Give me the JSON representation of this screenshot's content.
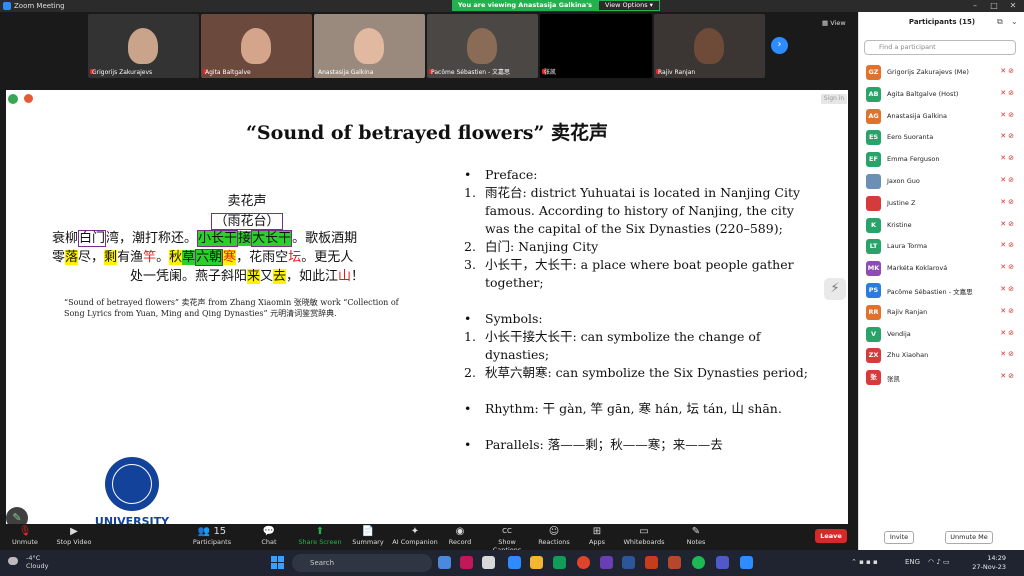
{
  "window": {
    "title": "Zoom Meeting",
    "banner": "You are viewing Anastasija Galkina's screen",
    "view_options": "View Options",
    "view_label": "View"
  },
  "tiles": [
    {
      "name": "Grigorijs Zakurajevs",
      "muted": true,
      "color": "#5a4637"
    },
    {
      "name": "Agita Baltgalve",
      "muted": true,
      "color": "#6b4a3d"
    },
    {
      "name": "Anastasija Galkina",
      "muted": false,
      "color": "#7a6a5e"
    },
    {
      "name": "Pacôme Sébastien - 文嘉思",
      "muted": true,
      "color": "#3a3a3a"
    },
    {
      "name": "张凯",
      "muted": true,
      "color": "#000000"
    },
    {
      "name": "Rajiv Ranjan",
      "muted": true,
      "color": "#2e2a28"
    }
  ],
  "slide": {
    "sign_in": "Sign in",
    "title": "“Sound of betrayed flowers” 卖花声",
    "poem": {
      "title": "卖花声",
      "subtitle": "（雨花台）",
      "l1a": "衰柳",
      "l1b": "白门",
      "l1c": "湾，潮打称还。",
      "l1d": "小长干",
      "l1e": "接",
      "l1f": "大长干",
      "l1g": "。歌板酒期",
      "l2a": "零",
      "l2b": "落",
      "l2c": "尽，",
      "l2d": "剩",
      "l2e": "有渔",
      "l2f": "竿",
      "l2g": "。",
      "l2h": "秋",
      "l2i": "草",
      "l2j": "六朝",
      "l2k": "寒",
      "l2l": "，花雨空",
      "l2m": "坛",
      "l2n": "。更无人",
      "l3a": "处一凭阑。燕子斜阳",
      "l3b": "来",
      "l3c": "又",
      "l3d": "去",
      "l3e": "，如此江",
      "l3f": "山",
      "l3g": "！"
    },
    "citation": "“Sound of betrayed flowers” 卖花声 from Zhang Xiaomin 张晓敏 work “Collection of Song Lyrics from Yuan, Ming and Qing Dynasties” 元明清词鉴赏辞典.",
    "preface_label": "Preface:",
    "preface_items": [
      "雨花台: district Yuhuatai is located in Nanjing City famous. According to history of Nanjing, the city was the capital of the Six Dynasties (220–589);",
      "白门: Nanjing City",
      "小长干，大长干: a place where boat people gather together;"
    ],
    "symbols_label": "Symbols:",
    "symbols_items": [
      "小长干接大长干: can symbolize the change of dynasties;",
      "秋草六朝寒: can symbolize the Six Dynasties period;"
    ],
    "rhythm": "Rhythm: 干 gàn, 竿 gān, 寒 hán, 坛 tán, 山 shān.",
    "parallels": "Parallels: 落——剩；秋——寒；来——去",
    "logo_text": "UNIVERSITY"
  },
  "toolbar": [
    {
      "label": "Unmute",
      "icon": "mic-off-icon",
      "glyph": "🎙"
    },
    {
      "label": "Stop Video",
      "icon": "video-icon",
      "glyph": "▶"
    },
    {
      "label": "Participants",
      "icon": "participants-icon",
      "glyph": "👥 15"
    },
    {
      "label": "Chat",
      "icon": "chat-icon",
      "glyph": "💬"
    },
    {
      "label": "Share Screen",
      "icon": "share-screen-icon",
      "glyph": "⬆"
    },
    {
      "label": "Summary",
      "icon": "summary-icon",
      "glyph": "📄"
    },
    {
      "label": "AI Companion",
      "icon": "ai-companion-icon",
      "glyph": "✦"
    },
    {
      "label": "Record",
      "icon": "record-icon",
      "glyph": "◉"
    },
    {
      "label": "Show Captions",
      "icon": "captions-icon",
      "glyph": "CC"
    },
    {
      "label": "Reactions",
      "icon": "reactions-icon",
      "glyph": "☺"
    },
    {
      "label": "Apps",
      "icon": "apps-icon",
      "glyph": "⊞"
    },
    {
      "label": "Whiteboards",
      "icon": "whiteboard-icon",
      "glyph": "▭"
    },
    {
      "label": "Notes",
      "icon": "notes-icon",
      "glyph": "✎"
    }
  ],
  "leave_label": "Leave",
  "participants": {
    "title": "Participants (15)",
    "search_placeholder": "Find a participant",
    "list": [
      {
        "initials": "GZ",
        "name": "Grigorijs Zakurajevs (Me)",
        "color": "#e0722b"
      },
      {
        "initials": "AB",
        "name": "Agita Baltgalve (Host)",
        "color": "#28a36a"
      },
      {
        "initials": "AG",
        "name": "Anastasija Galkina",
        "color": "#e0722b"
      },
      {
        "initials": "ES",
        "name": "Eero Suoranta",
        "color": "#28a36a"
      },
      {
        "initials": "EF",
        "name": "Emma Ferguson",
        "color": "#28a36a"
      },
      {
        "initials": "",
        "name": "Jaxon Guo",
        "color": "#6b8fb5"
      },
      {
        "initials": "",
        "name": "Justine Z",
        "color": "#d63b3b"
      },
      {
        "initials": "K",
        "name": "Kristine",
        "color": "#28a36a"
      },
      {
        "initials": "LT",
        "name": "Laura Torma",
        "color": "#28a36a"
      },
      {
        "initials": "MK",
        "name": "Markéta Koklarová",
        "color": "#8c4bb5"
      },
      {
        "initials": "PS",
        "name": "Pacôme Sébastien - 文嘉思",
        "color": "#2d7be0"
      },
      {
        "initials": "RR",
        "name": "Rajiv Ranjan",
        "color": "#e0722b"
      },
      {
        "initials": "V",
        "name": "Vendija",
        "color": "#28a36a"
      },
      {
        "initials": "ZX",
        "name": "Zhu Xiaohan",
        "color": "#d63b3b"
      },
      {
        "initials": "张",
        "name": "张凯",
        "color": "#d63b3b"
      }
    ],
    "invite": "Invite",
    "unmute_me": "Unmute Me"
  },
  "taskbar": {
    "temp": "-4°C",
    "condition": "Cloudy",
    "search": "Search",
    "lang": "ENG",
    "time": "14:29",
    "date": "27-Nov-23"
  }
}
